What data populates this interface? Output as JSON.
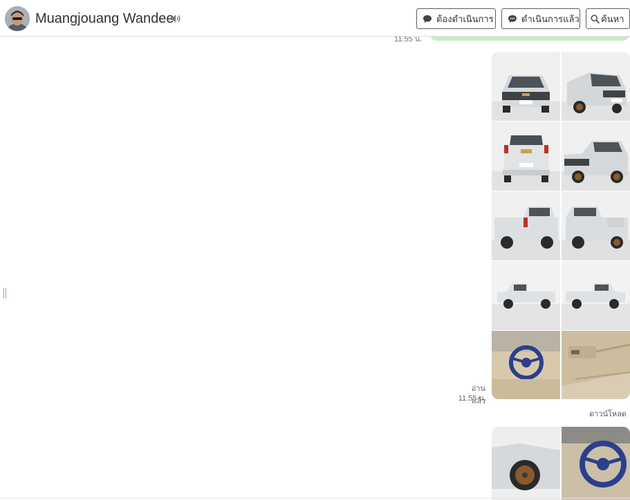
{
  "header": {
    "contact_name": "Muangjouang Wandee",
    "buttons": {
      "pending": "ต้องดำเนินการ",
      "done": "ดำเนินการแล้ว",
      "search": "ค้นหา"
    }
  },
  "messages": {
    "previous_time": "11.55 น.",
    "album": {
      "read_label": "อ่านแล้ว",
      "time": "11.55 น.",
      "download_label": "ดาวน์โหลด"
    }
  },
  "colors": {
    "sent_bubble": "#c6edc2",
    "button_border": "#5c5c5c",
    "vehicle": "#d9dcdf",
    "showroom_floor": "#ececec"
  },
  "icons": {
    "avatar": "avatar",
    "speaker": "speaker-icon",
    "pending": "chat-bubble-icon",
    "done": "chat-bubble-dots-icon",
    "search": "search-icon",
    "resize": "resize-handle-icon"
  }
}
